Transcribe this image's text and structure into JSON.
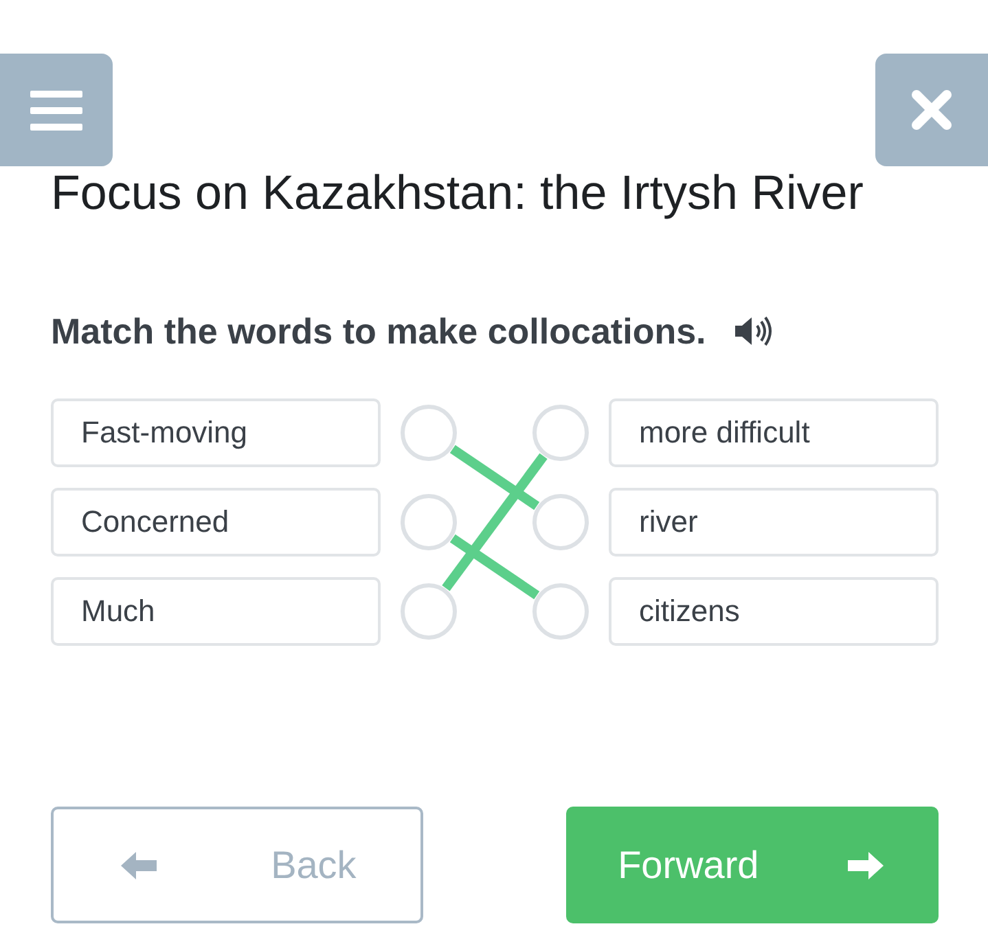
{
  "title": "Focus on Kazakhstan: the Irtysh River",
  "instruction": "Match the words to make collocations.",
  "left_items": [
    {
      "text": "Fast-moving",
      "kind": "one_down"
    },
    {
      "text": "Concerned",
      "kind": "one_down"
    },
    {
      "text": "Much",
      "kind": "two_up"
    }
  ],
  "right_items": [
    "more difficult",
    "river",
    "citizens"
  ],
  "buttons": {
    "back": "Back",
    "forward": "Forward"
  }
}
